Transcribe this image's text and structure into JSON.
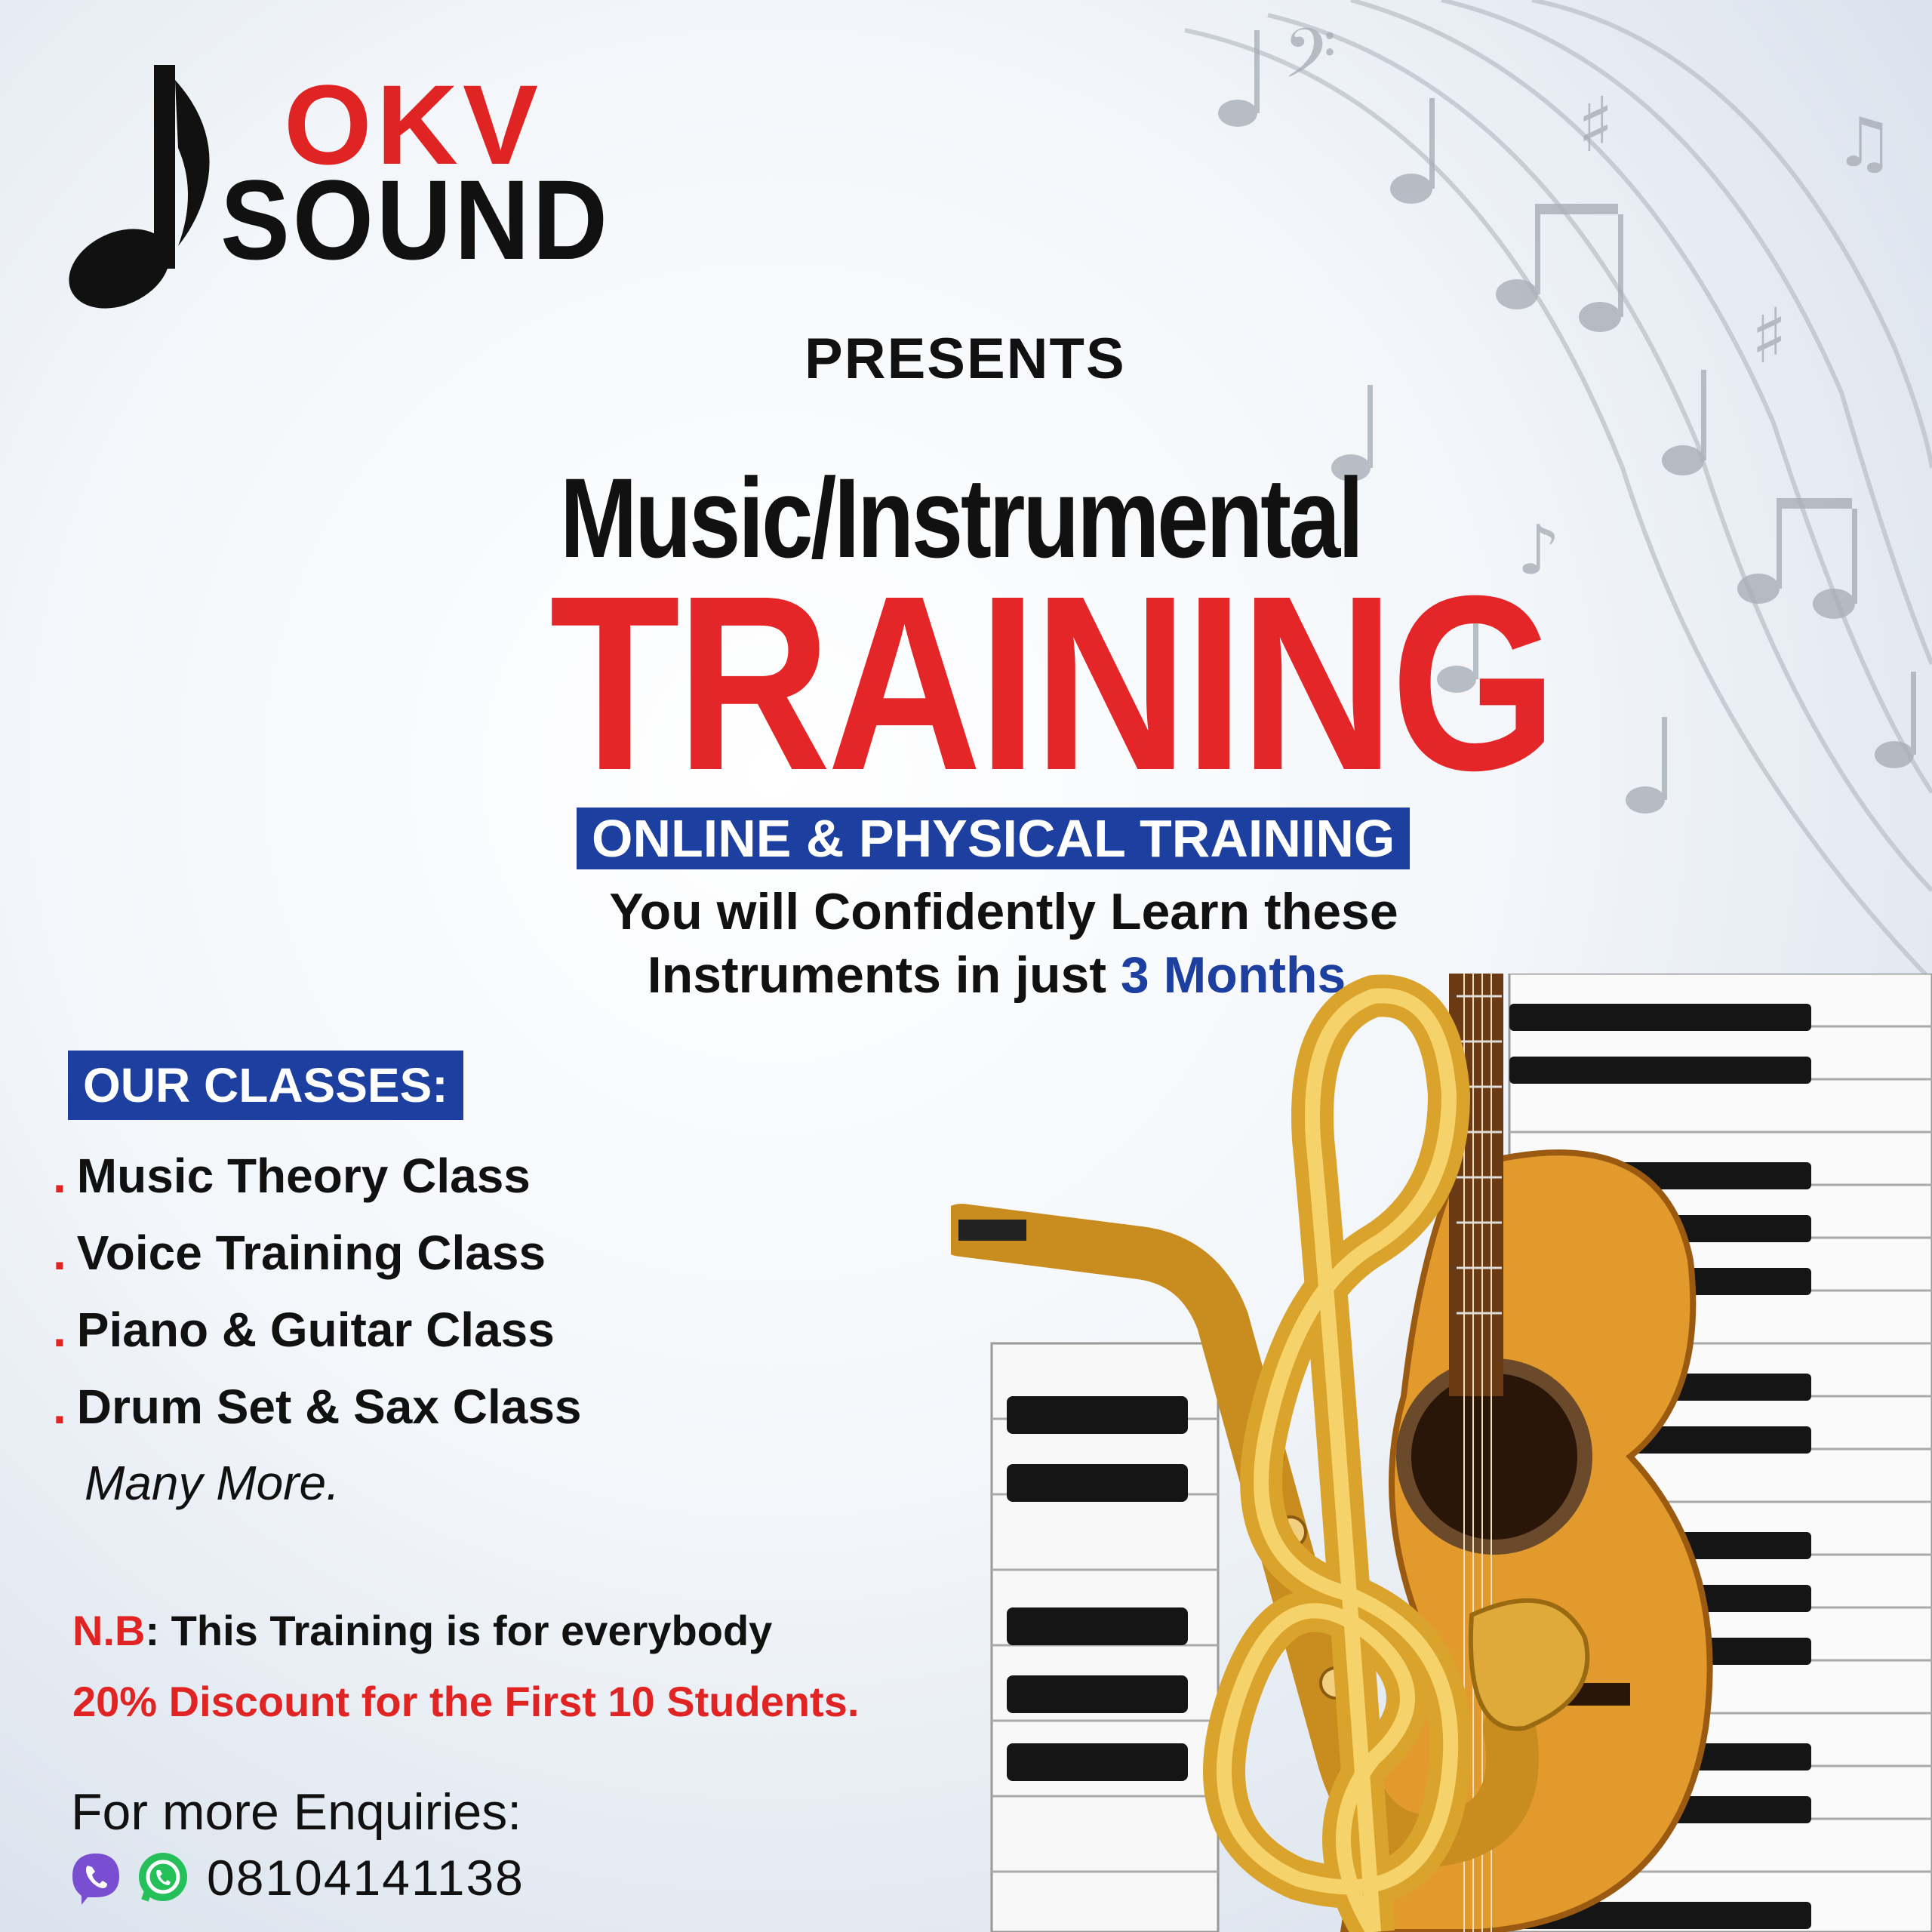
{
  "brand": {
    "line1": "OKV",
    "line2": "SOUND",
    "logo_icon": "music-note-icon"
  },
  "presents": "PRESENTS",
  "headline": "Music/Instrumental",
  "headline_big": "TRAINING",
  "banner": "ONLINE & PHYSICAL TRAINING",
  "subline1": "You will Confidently Learn these",
  "subline2_prefix": "Instruments in just",
  "subline2_highlight": "3 Months.",
  "classes": {
    "heading": "OUR CLASSES:",
    "items": [
      {
        "bullet": ".",
        "label": "Music Theory Class"
      },
      {
        "bullet": ".",
        "label": "Voice Training Class"
      },
      {
        "bullet": ".",
        "label": "Piano & Guitar Class"
      },
      {
        "bullet": ".",
        "label": "Drum Set & Sax Class"
      }
    ],
    "more": "Many More."
  },
  "note": {
    "prefix": "N.B",
    "text": ": This Training is for everybody"
  },
  "discount": "20% Discount for the First 10 Students.",
  "enquiries": {
    "label": "For more Enquiries:",
    "phone": "08104141138",
    "icons": [
      "viber-icon",
      "whatsapp-icon"
    ]
  },
  "colors": {
    "accent_red": "#e52629",
    "accent_blue": "#1d40a0",
    "text": "#111111"
  }
}
